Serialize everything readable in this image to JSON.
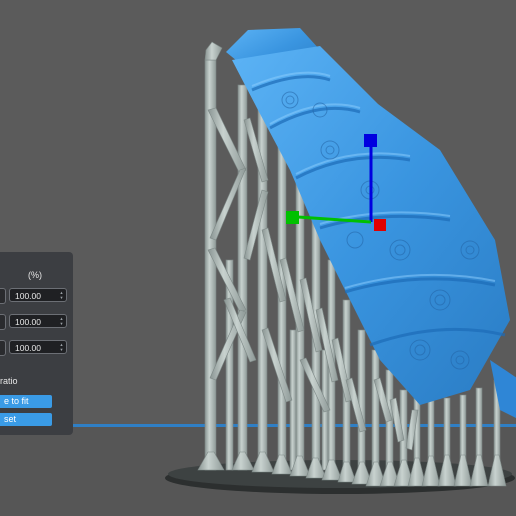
{
  "scale_panel": {
    "column_header": "(%)",
    "rows": [
      {
        "value": "100.00"
      },
      {
        "value": "100.00"
      },
      {
        "value": "100.00"
      }
    ],
    "ratio_label": "ratio",
    "scale_to_fit_label": "e to fit",
    "reset_label": "set"
  },
  "colors": {
    "background": "#5b5b5b",
    "model": "#3d9be8",
    "supports": "#a9b5b2",
    "axis_x": "#e00000",
    "axis_y": "#00c000",
    "axis_z": "#0000e0",
    "panel": "#3c3e42",
    "accent": "#3a9be6"
  }
}
